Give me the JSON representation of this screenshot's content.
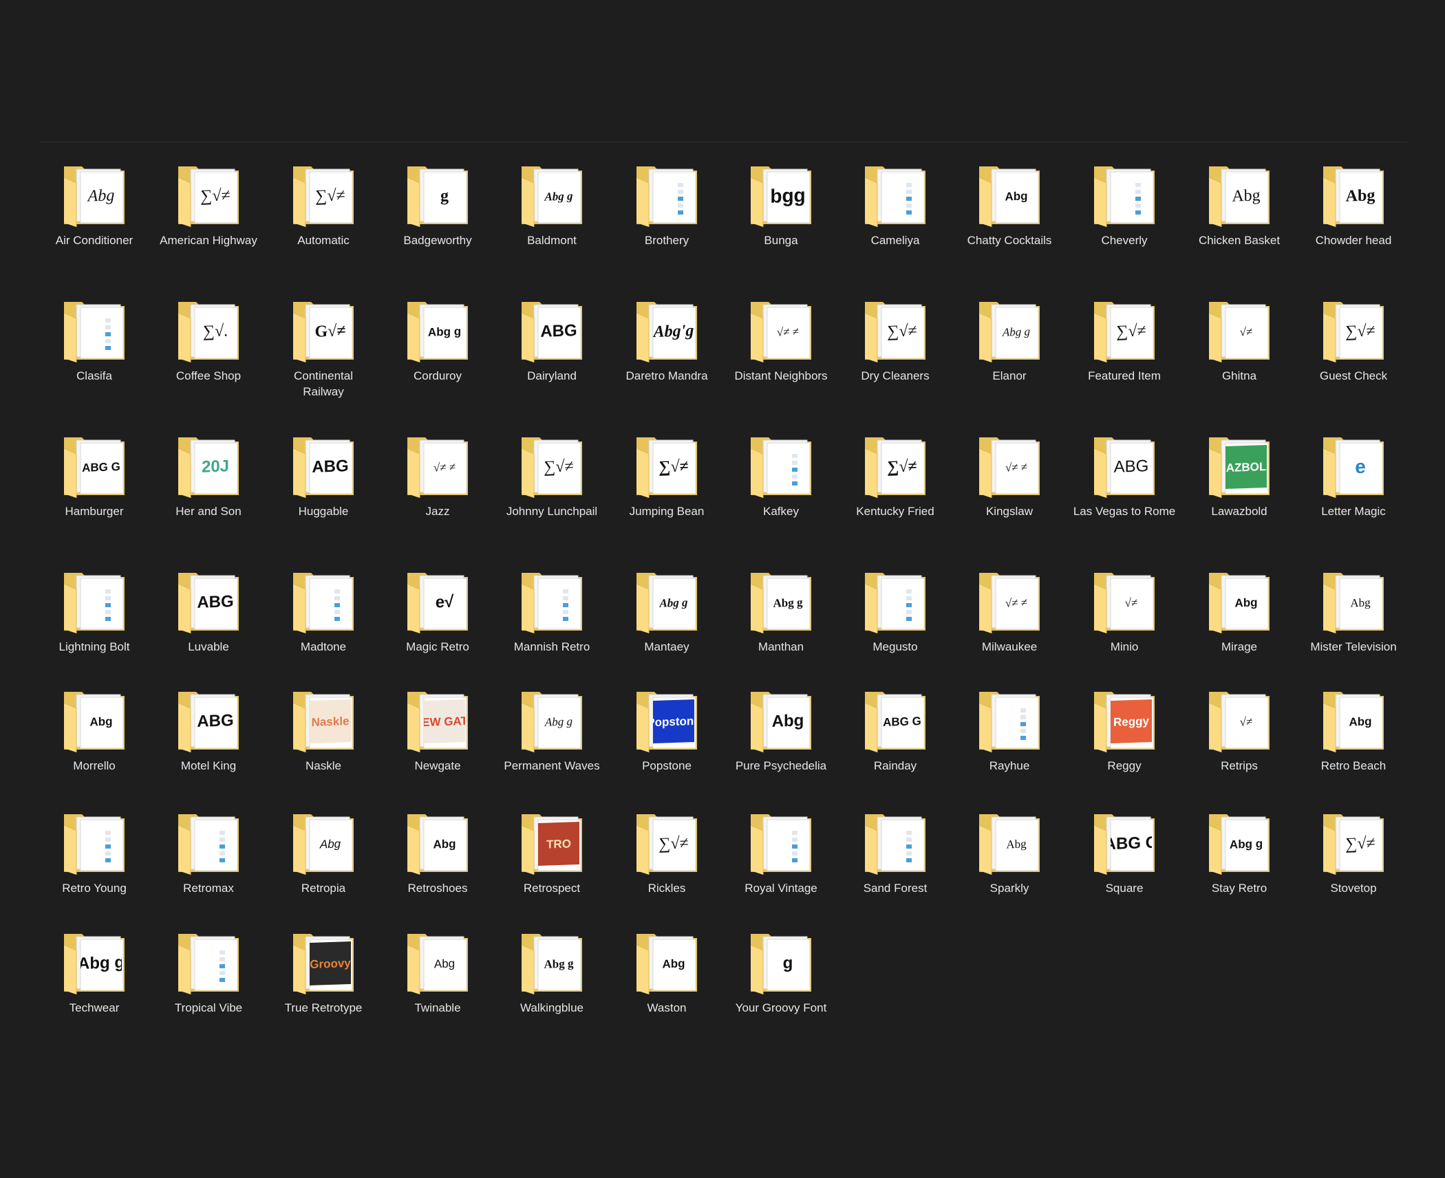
{
  "colors": {
    "background": "#1e1e1e",
    "folder_back": "#e8c35a",
    "folder_front": "#fbdc84",
    "label_text": "#e6e6e6"
  },
  "folders": [
    {
      "label": "Air Conditioner",
      "icon": "folder-icon",
      "sample": "Abg"
    },
    {
      "label": "American Highway",
      "icon": "folder-icon",
      "sample": "∑√≠"
    },
    {
      "label": "Automatic",
      "icon": "folder-icon",
      "sample": "∑√≠"
    },
    {
      "label": "Badgeworthy",
      "icon": "folder-icon",
      "sample": "g"
    },
    {
      "label": "Baldmont",
      "icon": "folder-icon",
      "sample": "Abg g"
    },
    {
      "label": "Brothery",
      "icon": "folder-icon",
      "sample": ""
    },
    {
      "label": "Bunga",
      "icon": "folder-icon",
      "sample": "bgg"
    },
    {
      "label": "Cameliya",
      "icon": "folder-icon",
      "sample": ""
    },
    {
      "label": "Chatty Cocktails",
      "icon": "folder-icon",
      "sample": "Abg"
    },
    {
      "label": "Cheverly",
      "icon": "folder-icon",
      "sample": ""
    },
    {
      "label": "Chicken Basket",
      "icon": "folder-icon",
      "sample": "Abg"
    },
    {
      "label": "Chowder head",
      "icon": "folder-icon",
      "sample": "Abg"
    },
    {
      "label": "Clasifa",
      "icon": "folder-icon",
      "sample": ""
    },
    {
      "label": "Coffee Shop",
      "icon": "folder-icon",
      "sample": "∑√."
    },
    {
      "label": "Continental Railway",
      "icon": "folder-icon",
      "sample": "G√≠"
    },
    {
      "label": "Corduroy",
      "icon": "folder-icon",
      "sample": "Abg g"
    },
    {
      "label": "Dairyland",
      "icon": "folder-icon",
      "sample": "ABG"
    },
    {
      "label": "Daretro Mandra",
      "icon": "folder-icon",
      "sample": "Abg'g"
    },
    {
      "label": "Distant Neighbors",
      "icon": "folder-icon",
      "sample": "√≠ ≠"
    },
    {
      "label": "Dry Cleaners",
      "icon": "folder-icon",
      "sample": "∑√≠"
    },
    {
      "label": "Elanor",
      "icon": "folder-icon",
      "sample": "Abg g"
    },
    {
      "label": "Featured Item",
      "icon": "folder-icon",
      "sample": "∑√≠"
    },
    {
      "label": "Ghitna",
      "icon": "folder-icon",
      "sample": "√≠"
    },
    {
      "label": "Guest Check",
      "icon": "folder-icon",
      "sample": "∑√≠"
    },
    {
      "label": "Hamburger",
      "icon": "folder-icon",
      "sample": "ABG G"
    },
    {
      "label": "Her and Son",
      "icon": "folder-icon",
      "sample": "20J"
    },
    {
      "label": "Huggable",
      "icon": "folder-icon",
      "sample": "ABG"
    },
    {
      "label": "Jazz",
      "icon": "folder-icon",
      "sample": "√≠ ≠"
    },
    {
      "label": "Johnny Lunchpail",
      "icon": "folder-icon",
      "sample": "∑√≠"
    },
    {
      "label": "Jumping Bean",
      "icon": "folder-icon",
      "sample": "∑√≠"
    },
    {
      "label": "Kafkey",
      "icon": "folder-icon",
      "sample": ""
    },
    {
      "label": "Kentucky Fried",
      "icon": "folder-icon",
      "sample": "∑√≠"
    },
    {
      "label": "Kingslaw",
      "icon": "folder-icon",
      "sample": "√≠ ≠"
    },
    {
      "label": "Las Vegas to Rome",
      "icon": "folder-icon",
      "sample": "ABG"
    },
    {
      "label": "Lawazbold",
      "icon": "folder-icon",
      "sample": "AZBOL"
    },
    {
      "label": "Letter Magic",
      "icon": "folder-icon",
      "sample": "e"
    },
    {
      "label": "Lightning Bolt",
      "icon": "folder-icon",
      "sample": ""
    },
    {
      "label": "Luvable",
      "icon": "folder-icon",
      "sample": "ABG"
    },
    {
      "label": "Madtone",
      "icon": "folder-icon",
      "sample": ""
    },
    {
      "label": "Magic Retro",
      "icon": "folder-icon",
      "sample": "e√"
    },
    {
      "label": "Mannish Retro",
      "icon": "folder-icon",
      "sample": ""
    },
    {
      "label": "Mantaey",
      "icon": "folder-icon",
      "sample": "Abg g"
    },
    {
      "label": "Manthan",
      "icon": "folder-icon",
      "sample": "Abg g"
    },
    {
      "label": "Megusto",
      "icon": "folder-icon",
      "sample": ""
    },
    {
      "label": "Milwaukee",
      "icon": "folder-icon",
      "sample": "√≠ ≠"
    },
    {
      "label": "Minio",
      "icon": "folder-icon",
      "sample": "√≠"
    },
    {
      "label": "Mirage",
      "icon": "folder-icon",
      "sample": "Abg"
    },
    {
      "label": "Mister Television",
      "icon": "folder-icon",
      "sample": "Abg"
    },
    {
      "label": "Morrello",
      "icon": "folder-icon",
      "sample": "Abg"
    },
    {
      "label": "Motel King",
      "icon": "folder-icon",
      "sample": "ABG"
    },
    {
      "label": "Naskle",
      "icon": "folder-icon",
      "sample": "Naskle"
    },
    {
      "label": "Newgate",
      "icon": "folder-icon",
      "sample": "NEW GATE"
    },
    {
      "label": "Permanent Waves",
      "icon": "folder-icon",
      "sample": "Abg g"
    },
    {
      "label": "Popstone",
      "icon": "folder-icon",
      "sample": "Popstone"
    },
    {
      "label": "Pure Psychedelia",
      "icon": "folder-icon",
      "sample": "Abg"
    },
    {
      "label": "Rainday",
      "icon": "folder-icon",
      "sample": "ABG G"
    },
    {
      "label": "Rayhue",
      "icon": "folder-icon",
      "sample": ""
    },
    {
      "label": "Reggy",
      "icon": "folder-icon",
      "sample": "Reggy"
    },
    {
      "label": "Retrips",
      "icon": "folder-icon",
      "sample": "√≠"
    },
    {
      "label": "Retro Beach",
      "icon": "folder-icon",
      "sample": "Abg"
    },
    {
      "label": "Retro Young",
      "icon": "folder-icon",
      "sample": ""
    },
    {
      "label": "Retromax",
      "icon": "folder-icon",
      "sample": ""
    },
    {
      "label": "Retropia",
      "icon": "folder-icon",
      "sample": "Abg"
    },
    {
      "label": "Retroshoes",
      "icon": "folder-icon",
      "sample": "Abg"
    },
    {
      "label": "Retrospect",
      "icon": "folder-icon",
      "sample": "TRO"
    },
    {
      "label": "Rickles",
      "icon": "folder-icon",
      "sample": "∑√≠"
    },
    {
      "label": "Royal Vintage",
      "icon": "folder-icon",
      "sample": ""
    },
    {
      "label": "Sand Forest",
      "icon": "folder-icon",
      "sample": ""
    },
    {
      "label": "Sparkly",
      "icon": "folder-icon",
      "sample": "Abg"
    },
    {
      "label": "Square",
      "icon": "folder-icon",
      "sample": "ABG G"
    },
    {
      "label": "Stay Retro",
      "icon": "folder-icon",
      "sample": "Abg g"
    },
    {
      "label": "Stovetop",
      "icon": "folder-icon",
      "sample": "∑√≠"
    },
    {
      "label": "Techwear",
      "icon": "folder-icon",
      "sample": "Abg g"
    },
    {
      "label": "Tropical Vibe",
      "icon": "folder-icon",
      "sample": ""
    },
    {
      "label": "True Retrotype",
      "icon": "folder-icon",
      "sample": "Groovy"
    },
    {
      "label": "Twinable",
      "icon": "folder-icon",
      "sample": "Abg"
    },
    {
      "label": "Walkingblue",
      "icon": "folder-icon",
      "sample": "Abg g"
    },
    {
      "label": "Waston",
      "icon": "folder-icon",
      "sample": "Abg"
    },
    {
      "label": "Your Groovy Font",
      "icon": "folder-icon",
      "sample": "g"
    }
  ]
}
